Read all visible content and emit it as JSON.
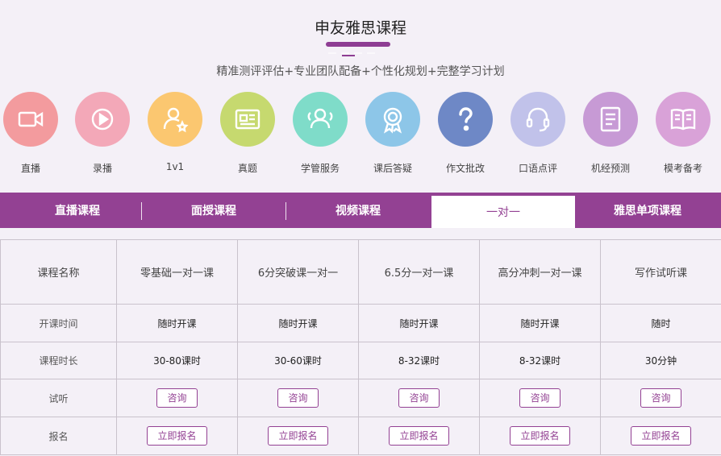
{
  "header": {
    "title": "申友雅思课程",
    "subtitle": "精准测评评估+专业团队配备+个性化规划+完整学习计划"
  },
  "features": [
    {
      "label": "直播",
      "icon": "video-camera-icon",
      "color": "#f39b9e"
    },
    {
      "label": "录播",
      "icon": "play-icon",
      "color": "#f3a8b8"
    },
    {
      "label": "1v1",
      "icon": "user-star-icon",
      "color": "#fbc770"
    },
    {
      "label": "真题",
      "icon": "document-card-icon",
      "color": "#c6d96f"
    },
    {
      "label": "学管服务",
      "icon": "team-icon",
      "color": "#7fdcc9"
    },
    {
      "label": "课后答疑",
      "icon": "badge-icon",
      "color": "#8dc6e8"
    },
    {
      "label": "作文批改",
      "icon": "question-icon",
      "color": "#6e88c6"
    },
    {
      "label": "口语点评",
      "icon": "headset-icon",
      "color": "#c1c2ea"
    },
    {
      "label": "机经预测",
      "icon": "document-list-icon",
      "color": "#c79ad5"
    },
    {
      "label": "模考备考",
      "icon": "book-icon",
      "color": "#d9a2d8"
    }
  ],
  "tabs": [
    "直播课程",
    "面授课程",
    "视频课程",
    "一对一",
    "雅思单项课程"
  ],
  "active_tab": "一对一",
  "table": {
    "header_label": "课程名称",
    "courses": [
      "零基础一对一课",
      "6分突破课一对一",
      "6.5分一对一课",
      "高分冲刺一对一课",
      "写作试听课"
    ],
    "rows": [
      {
        "label": "开课时间",
        "values": [
          "随时开课",
          "随时开课",
          "随时开课",
          "随时开课",
          "随时"
        ]
      },
      {
        "label": "课程时长",
        "values": [
          "30-80课时",
          "30-60课时",
          "8-32课时",
          "8-32课时",
          "30分钟"
        ]
      }
    ],
    "consult_label": "试听",
    "consult_button": "咨询",
    "signup_label": "报名",
    "signup_button": "立即报名"
  }
}
